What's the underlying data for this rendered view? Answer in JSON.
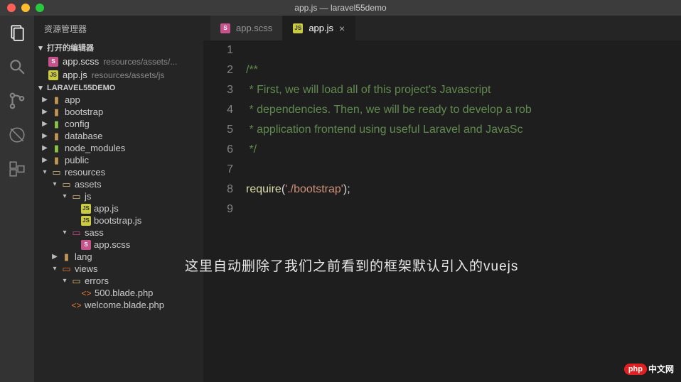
{
  "window": {
    "title": "app.js — laravel55demo"
  },
  "sidebar": {
    "title": "资源管理器",
    "openEditors": {
      "header": "打开的编辑器",
      "items": [
        {
          "icon": "scss",
          "name": "app.scss",
          "path": "resources/assets/..."
        },
        {
          "icon": "js",
          "name": "app.js",
          "path": "resources/assets/js"
        }
      ]
    },
    "project": {
      "header": "LARAVEL55DEMO",
      "tree": [
        {
          "indent": 0,
          "arrow": "▶",
          "icon": "folder",
          "label": "app"
        },
        {
          "indent": 0,
          "arrow": "▶",
          "icon": "folder",
          "label": "bootstrap"
        },
        {
          "indent": 0,
          "arrow": "▶",
          "icon": "folder-gr",
          "label": "config"
        },
        {
          "indent": 0,
          "arrow": "▶",
          "icon": "folder",
          "label": "database"
        },
        {
          "indent": 0,
          "arrow": "▶",
          "icon": "folder-gr",
          "label": "node_modules"
        },
        {
          "indent": 0,
          "arrow": "▶",
          "icon": "folder",
          "label": "public"
        },
        {
          "indent": 0,
          "arrow": "▾",
          "icon": "folder-open",
          "label": "resources"
        },
        {
          "indent": 1,
          "arrow": "▾",
          "icon": "folder-open",
          "label": "assets"
        },
        {
          "indent": 2,
          "arrow": "▾",
          "icon": "folder-open",
          "label": "js"
        },
        {
          "indent": 3,
          "arrow": "",
          "icon": "js",
          "label": "app.js"
        },
        {
          "indent": 3,
          "arrow": "",
          "icon": "js",
          "label": "bootstrap.js"
        },
        {
          "indent": 2,
          "arrow": "▾",
          "icon": "folder-sp",
          "label": "sass"
        },
        {
          "indent": 3,
          "arrow": "",
          "icon": "scss",
          "label": "app.scss"
        },
        {
          "indent": 1,
          "arrow": "▶",
          "icon": "folder",
          "label": "lang"
        },
        {
          "indent": 1,
          "arrow": "▾",
          "icon": "folder-or",
          "label": "views"
        },
        {
          "indent": 2,
          "arrow": "▾",
          "icon": "folder-open",
          "label": "errors"
        },
        {
          "indent": 3,
          "arrow": "",
          "icon": "html",
          "label": "500.blade.php"
        },
        {
          "indent": 2,
          "arrow": "",
          "icon": "html",
          "label": "welcome.blade.php"
        }
      ]
    }
  },
  "tabs": [
    {
      "icon": "scss",
      "label": "app.scss",
      "active": false
    },
    {
      "icon": "js",
      "label": "app.js",
      "active": true
    }
  ],
  "code": {
    "lines": [
      {
        "n": 1,
        "segs": []
      },
      {
        "n": 2,
        "segs": [
          {
            "t": "/**",
            "c": "g"
          }
        ]
      },
      {
        "n": 3,
        "segs": [
          {
            "t": " * First, we will load all of this project's Javascript",
            "c": "g"
          }
        ]
      },
      {
        "n": 4,
        "segs": [
          {
            "t": " * dependencies. Then, we will be ready to develop a rob",
            "c": "g"
          }
        ]
      },
      {
        "n": 5,
        "segs": [
          {
            "t": " * application frontend using useful Laravel and JavaSc",
            "c": "g"
          }
        ]
      },
      {
        "n": 6,
        "segs": [
          {
            "t": " */",
            "c": "g"
          }
        ]
      },
      {
        "n": 7,
        "segs": []
      },
      {
        "n": 8,
        "segs": [
          {
            "t": "require",
            "c": "y"
          },
          {
            "t": "(",
            "c": "w"
          },
          {
            "t": "'./bootstrap'",
            "c": "o"
          },
          {
            "t": ");",
            "c": "w"
          }
        ]
      },
      {
        "n": 9,
        "segs": []
      }
    ]
  },
  "annotation": "这里自动删除了我们之前看到的框架默认引入的vuejs",
  "watermark": {
    "badge": "php",
    "text": "中文网"
  }
}
